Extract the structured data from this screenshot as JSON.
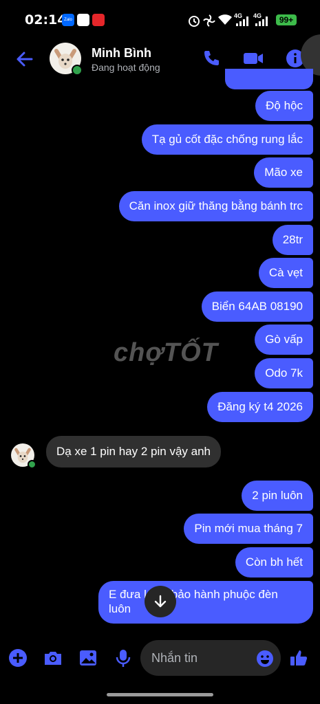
{
  "status_bar": {
    "time": "02:14",
    "apps": [
      "Zalo",
      "app",
      "app"
    ],
    "network": "4G",
    "network2": "4G",
    "battery": "99+"
  },
  "header": {
    "contact_name": "Minh Bình",
    "status": "Đang hoạt động"
  },
  "messages_out_top": [
    "Độ hộc",
    "Tạ gủ cốt đặc chống rung lắc",
    "Mão xe",
    "Căn inox giữ thăng bằng bánh trc",
    "28tr",
    "Cà vẹt",
    "Biển 64AB 08190",
    "Gò vấp",
    "Odo 7k",
    "Đăng ký t4 2026"
  ],
  "message_in": "Dạ xe 1 pin hay 2 pin vậy anh",
  "messages_out_bottom": [
    "2 pin luôn",
    "Pin mới mua tháng 7",
    "Còn bh hết"
  ],
  "message_last": {
    "line1": "E đưa l… ồ bảo hành phuộc đèn",
    "line2": "luôn"
  },
  "watermark": "chợTỐT",
  "composer": {
    "placeholder": "Nhắn tin"
  },
  "colors": {
    "accent": "#4a5cff",
    "incoming": "#303030",
    "background": "#000000",
    "online": "#31a24c"
  }
}
